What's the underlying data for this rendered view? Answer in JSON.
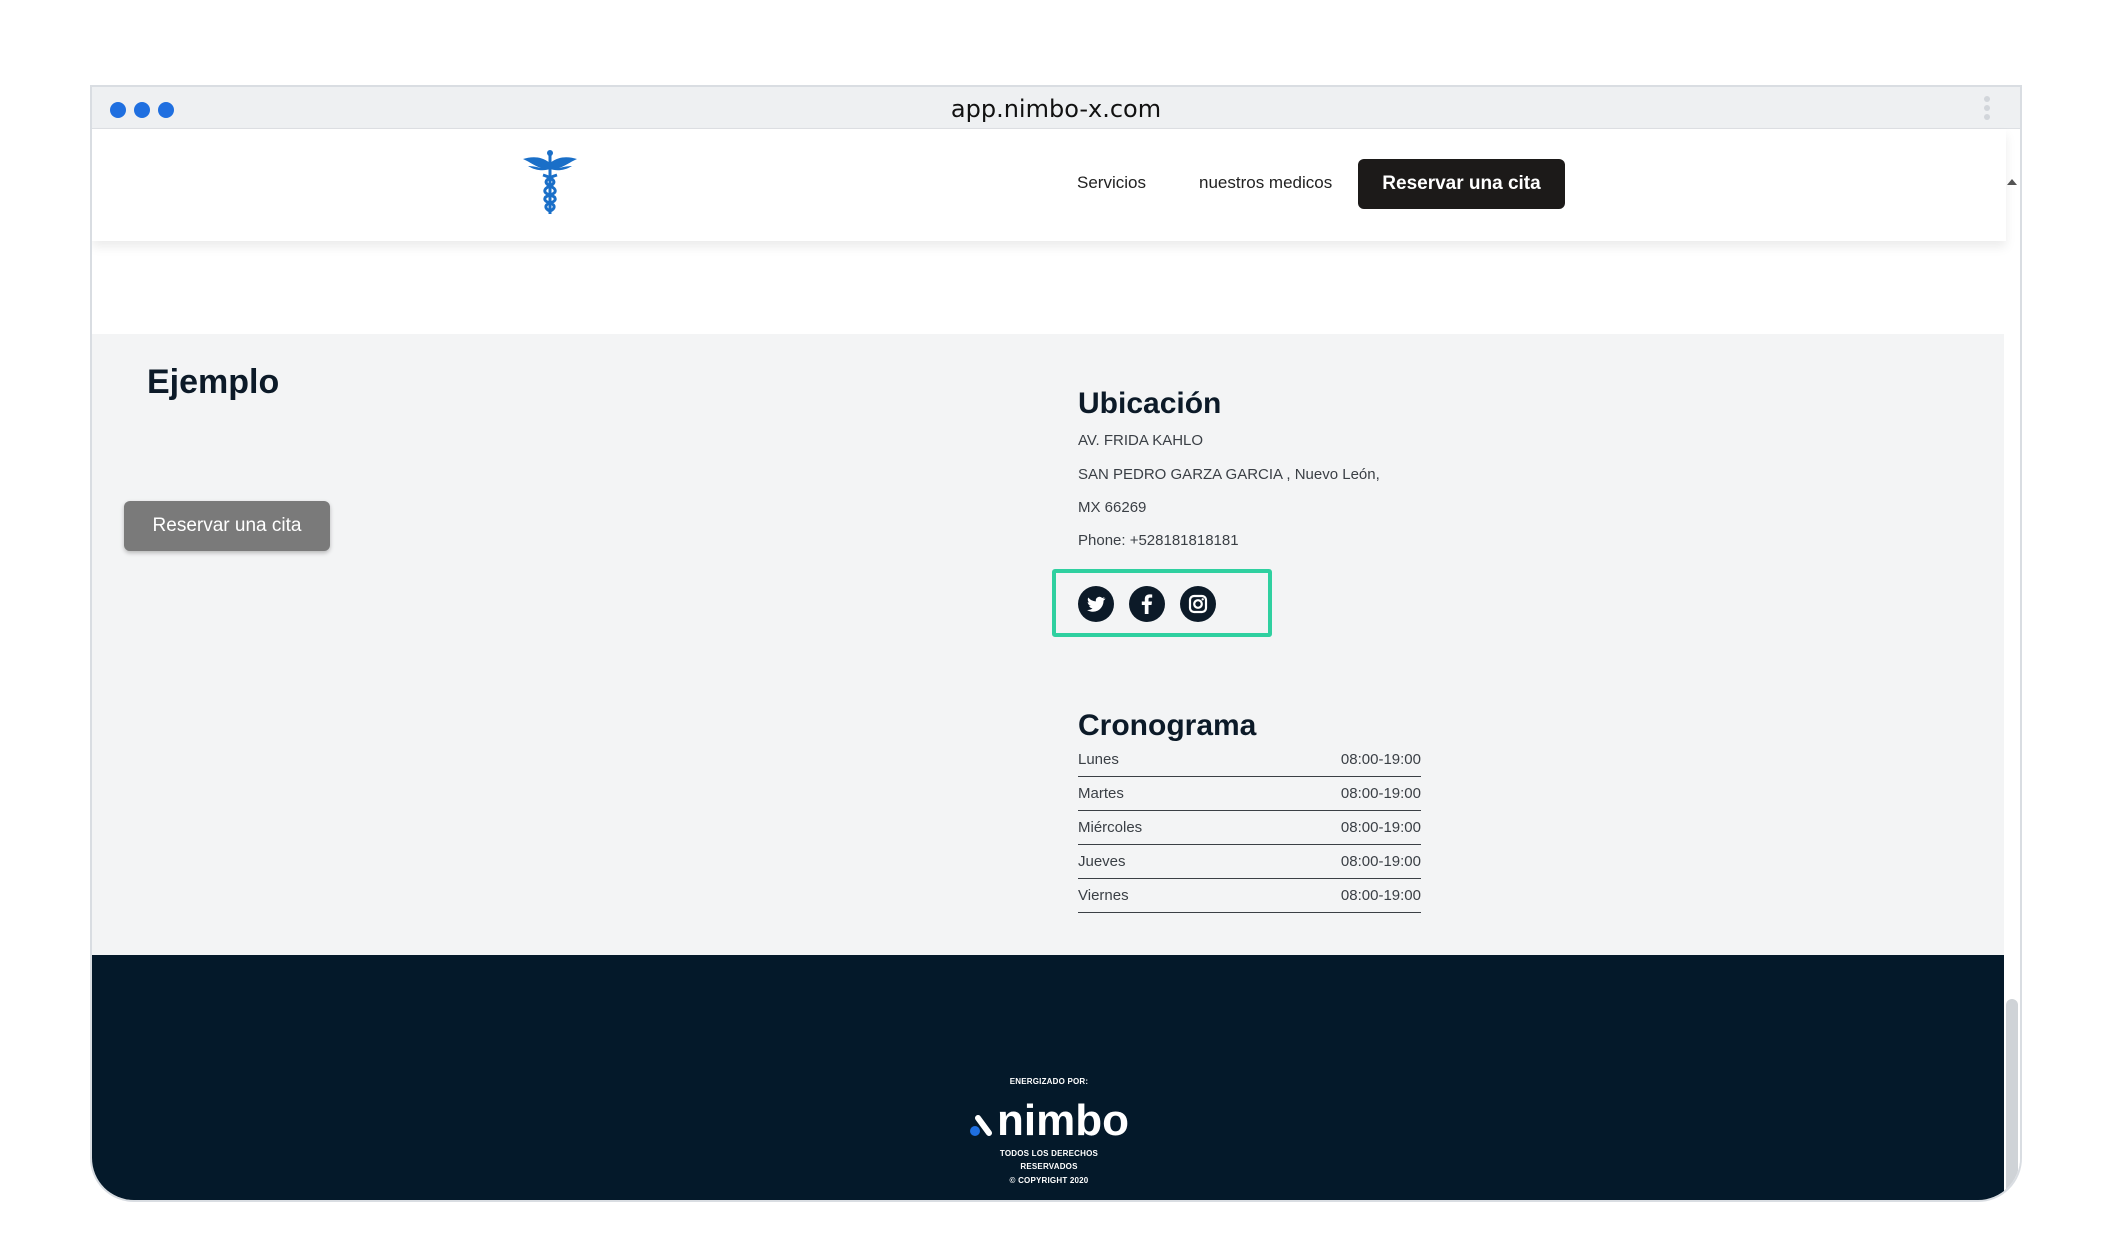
{
  "browser": {
    "url": "app.nimbo-x.com",
    "dot_color": "#1f6fe0"
  },
  "nav": {
    "links": [
      "Servicios",
      "nuestros medicos"
    ],
    "cta_label": "Reservar una cita",
    "logo_icon": "caduceus-icon"
  },
  "left": {
    "title": "Ejemplo",
    "cta_label": "Reservar una cita"
  },
  "location": {
    "title": "Ubicación",
    "lines": [
      "AV. FRIDA KAHLO",
      "SAN PEDRO GARZA GARCIA , Nuevo León,",
      "MX 66269",
      "Phone: +528181818181"
    ],
    "social_icons": [
      "twitter-icon",
      "facebook-icon",
      "instagram-icon"
    ],
    "highlight_color": "#2fd0a0"
  },
  "schedule": {
    "title": "Cronograma",
    "rows": [
      {
        "day": "Lunes",
        "hours": "08:00-19:00"
      },
      {
        "day": "Martes",
        "hours": "08:00-19:00"
      },
      {
        "day": "Miércoles",
        "hours": "08:00-19:00"
      },
      {
        "day": "Jueves",
        "hours": "08:00-19:00"
      },
      {
        "day": "Viernes",
        "hours": "08:00-19:00"
      }
    ]
  },
  "footer": {
    "powered_by": "ENERGIZADO POR:",
    "brand": "nimbo",
    "rights_line1": "TODOS LOS DERECHOS",
    "rights_line2": "RESERVADOS",
    "copyright": "© COPYRIGHT 2020",
    "background": "#04192a"
  }
}
